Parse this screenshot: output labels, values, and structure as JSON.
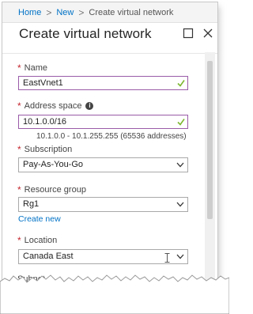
{
  "breadcrumb": {
    "home": "Home",
    "sep1": ">",
    "new": "New",
    "sep2": ">",
    "current": "Create virtual network"
  },
  "header": {
    "title": "Create virtual network",
    "maximize_icon": "maximize-icon",
    "close_icon": "close-icon"
  },
  "form": {
    "name": {
      "required_mark": "*",
      "label": "Name",
      "value": "EastVnet1",
      "valid": true
    },
    "address_space": {
      "required_mark": "*",
      "label": "Address space",
      "info_glyph": "i",
      "value": "10.1.0.0/16",
      "hint": "10.1.0.0 - 10.1.255.255 (65536 addresses)",
      "valid": true
    },
    "subscription": {
      "required_mark": "*",
      "label": "Subscription",
      "value": "Pay-As-You-Go"
    },
    "resource_group": {
      "required_mark": "*",
      "label": "Resource group",
      "value": "Rg1",
      "create_new": "Create new"
    },
    "location": {
      "required_mark": "*",
      "label": "Location",
      "value": "Canada East"
    },
    "subnet": {
      "label": "Subnet"
    }
  },
  "colors": {
    "accent_link": "#0072c6",
    "required": "#c4262e",
    "valid_check": "#7cb82f",
    "focus_border": "#9a5ba8"
  }
}
